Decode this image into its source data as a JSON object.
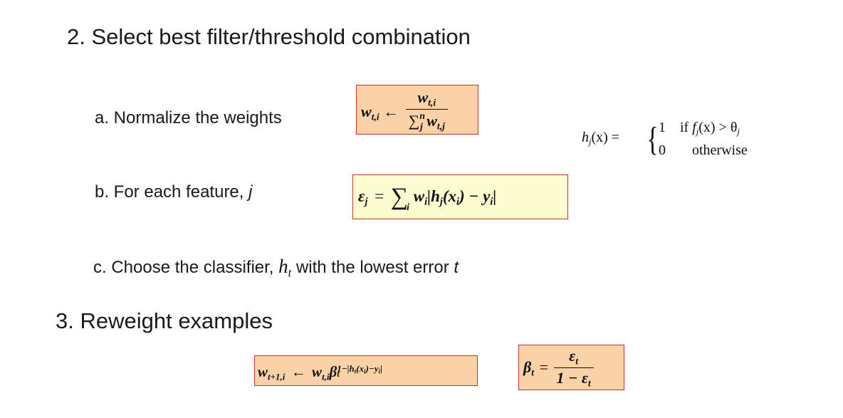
{
  "step2": {
    "heading": "2. Select best filter/threshold combination",
    "a_label": "a. Normalize the weights",
    "b_label_prefix": "b. For each feature, ",
    "b_label_var": "j",
    "c_label_prefix": "c. Choose the classifier, ",
    "c_label_suffix": " with the lowest error ",
    "c_label_var": "t"
  },
  "step3": {
    "heading": "3. Reweight examples"
  },
  "formulas": {
    "normalize": {
      "lhs": "w",
      "lhs_sub": "t,i",
      "arrow": "←",
      "num": "w",
      "num_sub": "t,i",
      "den_sigma": "∑",
      "den_sigma_sub": "j",
      "den_sigma_sup": "n",
      "den_w": "w",
      "den_sub": "t,j"
    },
    "error": {
      "lhs": "ε",
      "lhs_sub": "j",
      "eq": "=",
      "sigma": "∑",
      "sigma_sub": "i",
      "body": "w",
      "body_sub": "i",
      "abs_body": "|h",
      "abs_sub": "j",
      "abs_rest": "(x",
      "abs_x_sub": "i",
      "abs_end": ") − y",
      "abs_y_sub": "i",
      "abs_close": "|"
    },
    "classifier": {
      "sym": "h",
      "sub": "t"
    },
    "reweight": {
      "lhs": "w",
      "lhs_sub": "t+1,i",
      "arrow": "←",
      "rhs": "w",
      "rhs_sub": "t,i",
      "beta": "β",
      "beta_sub": "t",
      "beta_sup": "1−|h",
      "beta_sup_sub": "t",
      "beta_sup_rest": "(x",
      "beta_sup_x_sub": "i",
      "beta_sup_end": ")−y",
      "beta_sup_y_sub": "i",
      "beta_sup_close": "|"
    },
    "beta": {
      "lhs": "β",
      "lhs_sub": "t",
      "eq": "=",
      "num": "ε",
      "num_sub": "t",
      "den_pre": "1 − ε",
      "den_sub": "t"
    },
    "hypothesis": {
      "lhs": "h",
      "lhs_sub": "j",
      "lhs_arg": "(x) =",
      "case1_val": "1",
      "case1_cond_pre": "if ",
      "case1_f": "f",
      "case1_f_sub": "j",
      "case1_cond_mid": "(x) > θ",
      "case1_theta_sub": "j",
      "case2_val": "0",
      "case2_cond": "otherwise"
    }
  }
}
